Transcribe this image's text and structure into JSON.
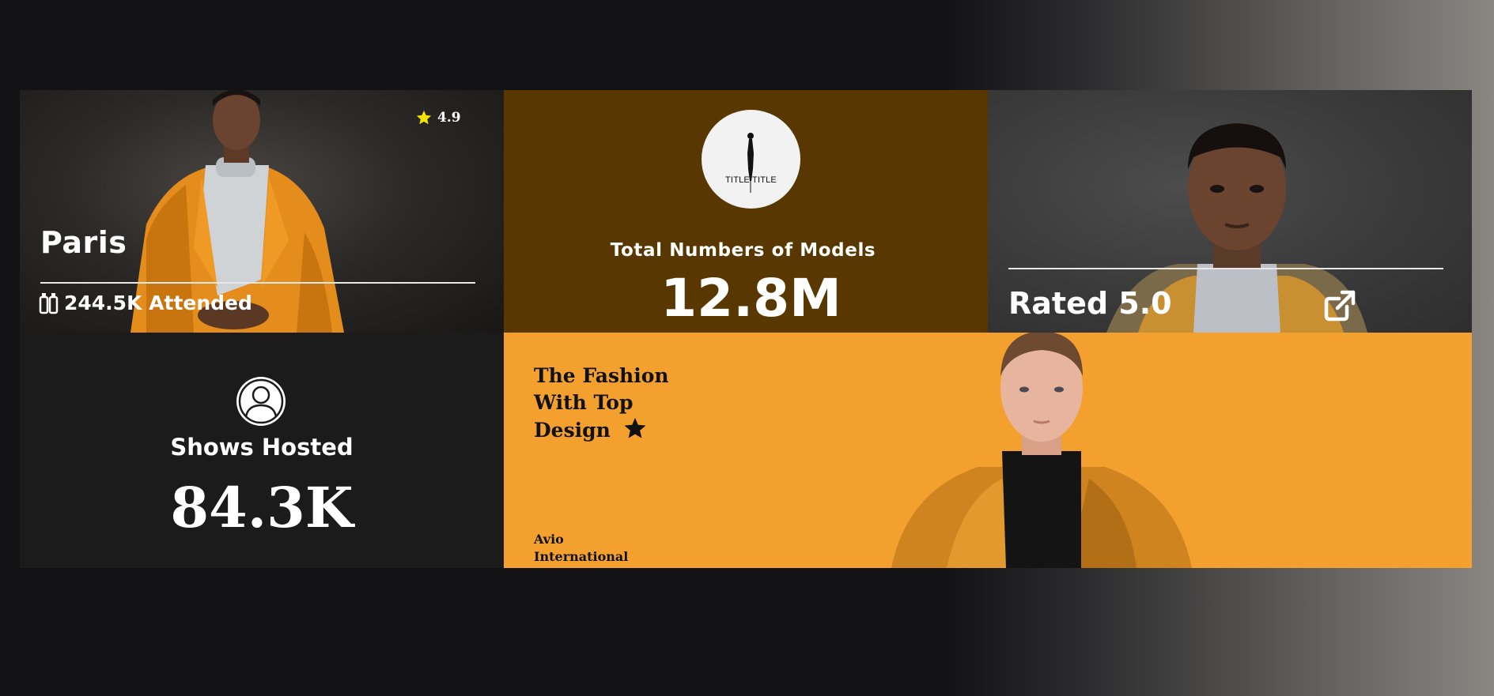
{
  "cards": {
    "paris": {
      "title": "Paris",
      "rating": "4.9",
      "rating_icon": "star-icon",
      "rating_color": "#f5e400",
      "attended": "244.5K Attended",
      "attended_icon": "ticket-icon"
    },
    "models": {
      "logo_text": "TITLE  TITLE",
      "label": "Total Numbers of Models",
      "value": "12.8M",
      "background": "#583800"
    },
    "rated": {
      "text": "Rated 5.0",
      "link_icon": "external-link-icon"
    },
    "shows": {
      "icon": "user-icon",
      "label": "Shows Hosted",
      "value": "84.3K"
    },
    "fashion": {
      "title_line1": "The Fashion",
      "title_line2": "With Top",
      "title_line3": "Design",
      "title_icon": "star-icon",
      "brand_line1": "Avio",
      "brand_line2": "International",
      "background": "#f3a02e"
    }
  }
}
